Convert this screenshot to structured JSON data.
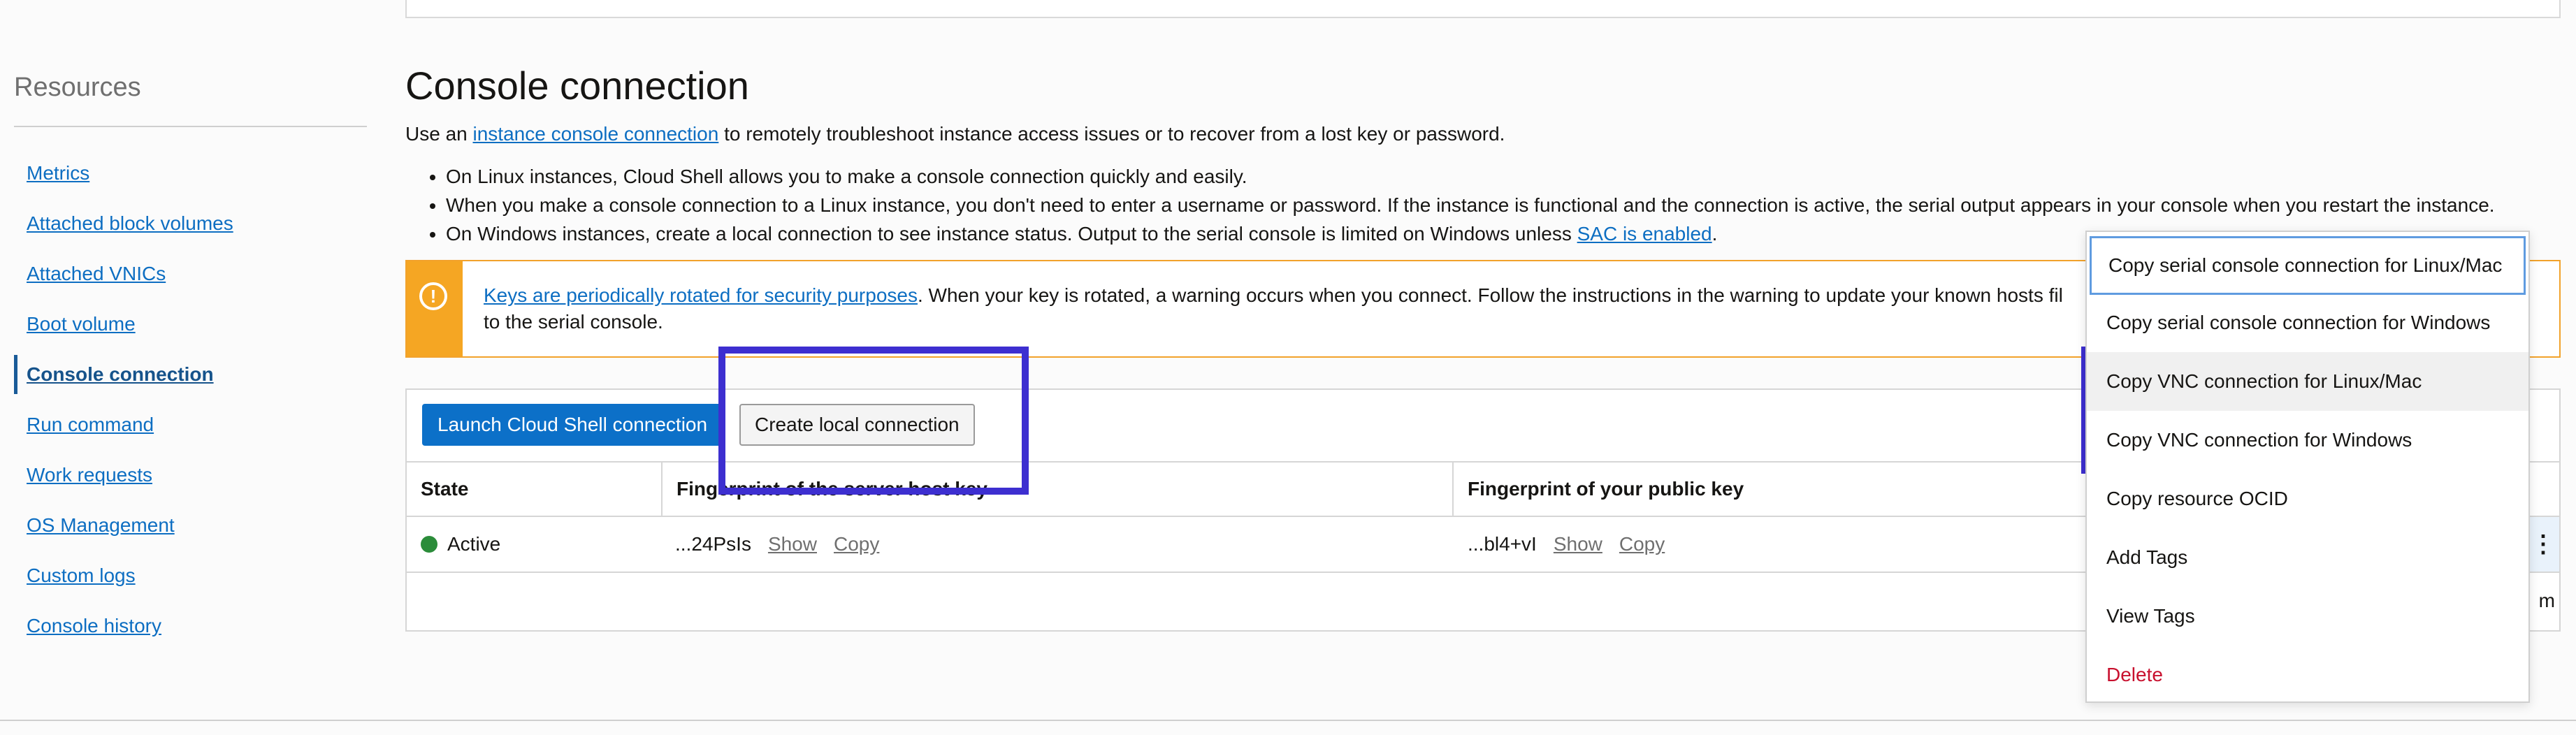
{
  "sidebar": {
    "heading": "Resources",
    "items": [
      {
        "label": "Metrics"
      },
      {
        "label": "Attached block volumes"
      },
      {
        "label": "Attached VNICs"
      },
      {
        "label": "Boot volume"
      },
      {
        "label": "Console connection",
        "active": true
      },
      {
        "label": "Run command"
      },
      {
        "label": "Work requests"
      },
      {
        "label": "OS Management"
      },
      {
        "label": "Custom logs"
      },
      {
        "label": "Console history"
      }
    ]
  },
  "main": {
    "title": "Console connection",
    "intro_prefix": "Use an ",
    "intro_link": "instance console connection",
    "intro_suffix": " to remotely troubleshoot instance access issues or to recover from a lost key or password.",
    "bullets": [
      "On Linux instances, Cloud Shell allows you to make a console connection quickly and easily.",
      "When you make a console connection to a Linux instance, you don't need to enter a username or password. If the instance is functional and the connection is active, the serial output appears in your console when you restart the instance."
    ],
    "bullet3_prefix": "On Windows instances, create a local connection to see instance status. Output to the serial console is limited on Windows unless ",
    "bullet3_link": "SAC is enabled",
    "bullet3_suffix": "."
  },
  "warning": {
    "icon": "exclamation-circle-icon",
    "link": "Keys are periodically rotated for security purposes",
    "text": ". When your key is rotated, a warning occurs when you connect. Follow the instructions in the warning to update your known hosts fil",
    "text_line2": "to the serial console."
  },
  "connection_panel": {
    "launch_button": "Launch Cloud Shell connection",
    "create_button": "Create local connection",
    "columns": [
      "State",
      "Fingerprint of the server host key",
      "Fingerprint of your public key"
    ],
    "row": {
      "state": "Active",
      "server_key": "...24PsIs",
      "public_key": "...bl4+vI",
      "show": "Show",
      "copy": "Copy"
    },
    "kebab_icon": "⋮",
    "footer_fragment": "m"
  },
  "menu": {
    "items": [
      {
        "label": "Copy serial console connection for Linux/Mac"
      },
      {
        "label": "Copy serial console connection for Windows"
      },
      {
        "label": "Copy VNC connection for Linux/Mac"
      },
      {
        "label": "Copy VNC connection for Windows"
      },
      {
        "label": "Copy resource OCID"
      },
      {
        "label": "Add Tags"
      },
      {
        "label": "View Tags"
      },
      {
        "label": "Delete"
      }
    ]
  },
  "colors": {
    "link": "#0d6ec2",
    "primary_button": "#0c70c8",
    "warning": "#f5a623",
    "highlight_box": "#3d2fd0",
    "status_active": "#2b8c3a",
    "danger": "#c8102e"
  }
}
